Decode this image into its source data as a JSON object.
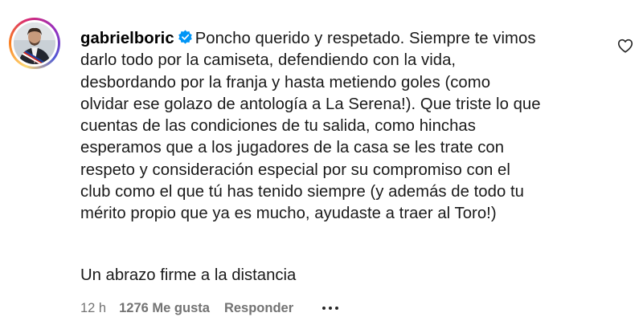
{
  "comment": {
    "username": "gabrielboric",
    "text_lines": [
      "Poncho querido y respetado. Siempre te vimos",
      "darlo todo por la camiseta, defendiendo con la vida,",
      "desbordando por la franja y hasta metiendo goles (como",
      "olvidar ese golazo de antología a La Serena!). Que triste lo que",
      "cuentas de las condiciones de tu salida, como hinchas",
      "esperamos que a los jugadores de la casa se les trate con",
      "respeto y consideración especial por su compromiso con el",
      "club como el que tú has tenido siempre (y además de todo tu",
      "mérito propio que ya es mucho, ayudaste a traer al Toro!)"
    ],
    "signoff": "Un abrazo firme a la distancia",
    "time": "12 h",
    "likes": "1276 Me gusta",
    "reply_label": "Responder"
  },
  "icons": {
    "verified": "verified-badge-icon",
    "like": "heart-outline-icon",
    "more": "more-options-icon"
  },
  "colors": {
    "verified_badge": "#0095f6",
    "meta_text": "#737373",
    "story_ring": [
      "#feda75",
      "#fa7e1e",
      "#d62976",
      "#962fbf",
      "#4f5bd5"
    ]
  }
}
